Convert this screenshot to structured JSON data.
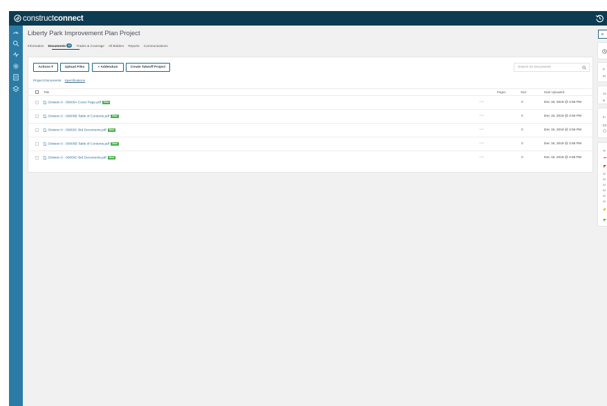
{
  "app": {
    "brand_light": "construct",
    "brand_bold": "connect"
  },
  "project": {
    "title": "Liberty Park Improvement Plan Project"
  },
  "tabs": [
    {
      "label": "Information"
    },
    {
      "label": "Documents",
      "badge": "12"
    },
    {
      "label": "Trades & Coverage"
    },
    {
      "label": "All Bidders"
    },
    {
      "label": "Reports"
    },
    {
      "label": "Communications"
    }
  ],
  "toolbar": {
    "actions_label": "Actions ▾",
    "upload_label": "Upload Files",
    "addendum_label": "+ Addendum",
    "takeoff_label": "Create Takeoff Project"
  },
  "search": {
    "placeholder": "Search for Documents"
  },
  "subnav": {
    "project_documents": "Project Documents",
    "specifications": "Specifications"
  },
  "table": {
    "headers": {
      "title": "Title",
      "pages": "Pages",
      "size": "Size",
      "date": "Date Uploaded"
    },
    "rows": [
      {
        "title": "Division 0 - 00000A Cover Page.pdf",
        "badge": "New",
        "size": "0",
        "date": "Dec 15, 2019 @ 2:56 PM"
      },
      {
        "title": "Division 0 - 00000B Table of Contents.pdf",
        "badge": "New",
        "size": "0",
        "date": "Dec 15, 2019 @ 2:56 PM"
      },
      {
        "title": "Division 0 - 00000C Bid Documents.pdf",
        "badge": "New",
        "size": "0",
        "date": "Dec 15, 2019 @ 2:56 PM"
      },
      {
        "title": "Division 0 - 00000B Table of Contents.pdf",
        "badge": "New",
        "size": "0",
        "date": "Dec 15, 2019 @ 2:56 PM"
      },
      {
        "title": "Division 0 - 00000C Bid Documents.pdf",
        "badge": "New",
        "size": "0",
        "date": "Dec 15, 2019 @ 2:55 PM"
      }
    ]
  },
  "right_panel": {
    "button_label": "C",
    "fragments": [
      "P",
      "Pr",
      "Ac",
      "N",
      "In",
      "Tr",
      "02",
      "02",
      "02",
      "02",
      "02",
      "02"
    ]
  },
  "colors": {
    "topbar": "#0d3b52",
    "rail": "#2a7ca6",
    "link": "#2a6f95",
    "new_badge": "#4cae4c",
    "background": "#f1f1f1"
  }
}
